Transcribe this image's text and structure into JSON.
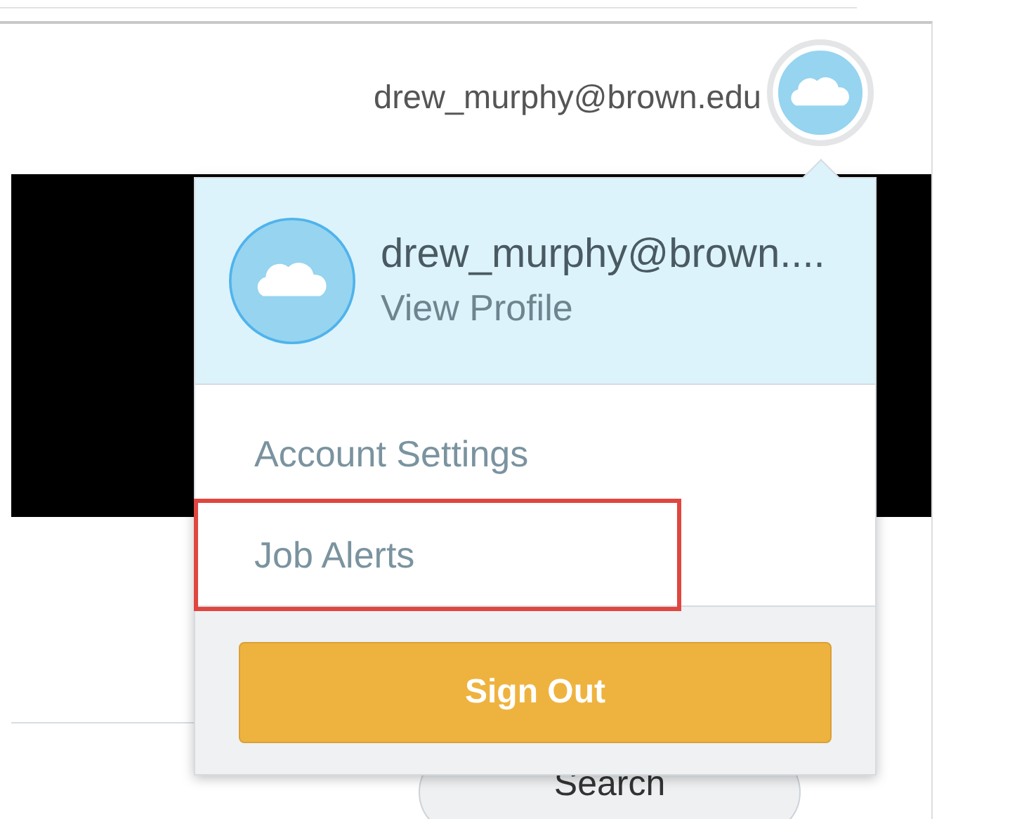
{
  "header": {
    "user_email": "drew_murphy@brown.edu"
  },
  "profile_menu": {
    "name": "drew_murphy@brown....",
    "link": "View Profile",
    "items": [
      {
        "label": "Account Settings",
        "highlighted": false
      },
      {
        "label": "Job Alerts",
        "highlighted": true
      }
    ],
    "sign_out": "Sign Out"
  },
  "search_button": "Search"
}
